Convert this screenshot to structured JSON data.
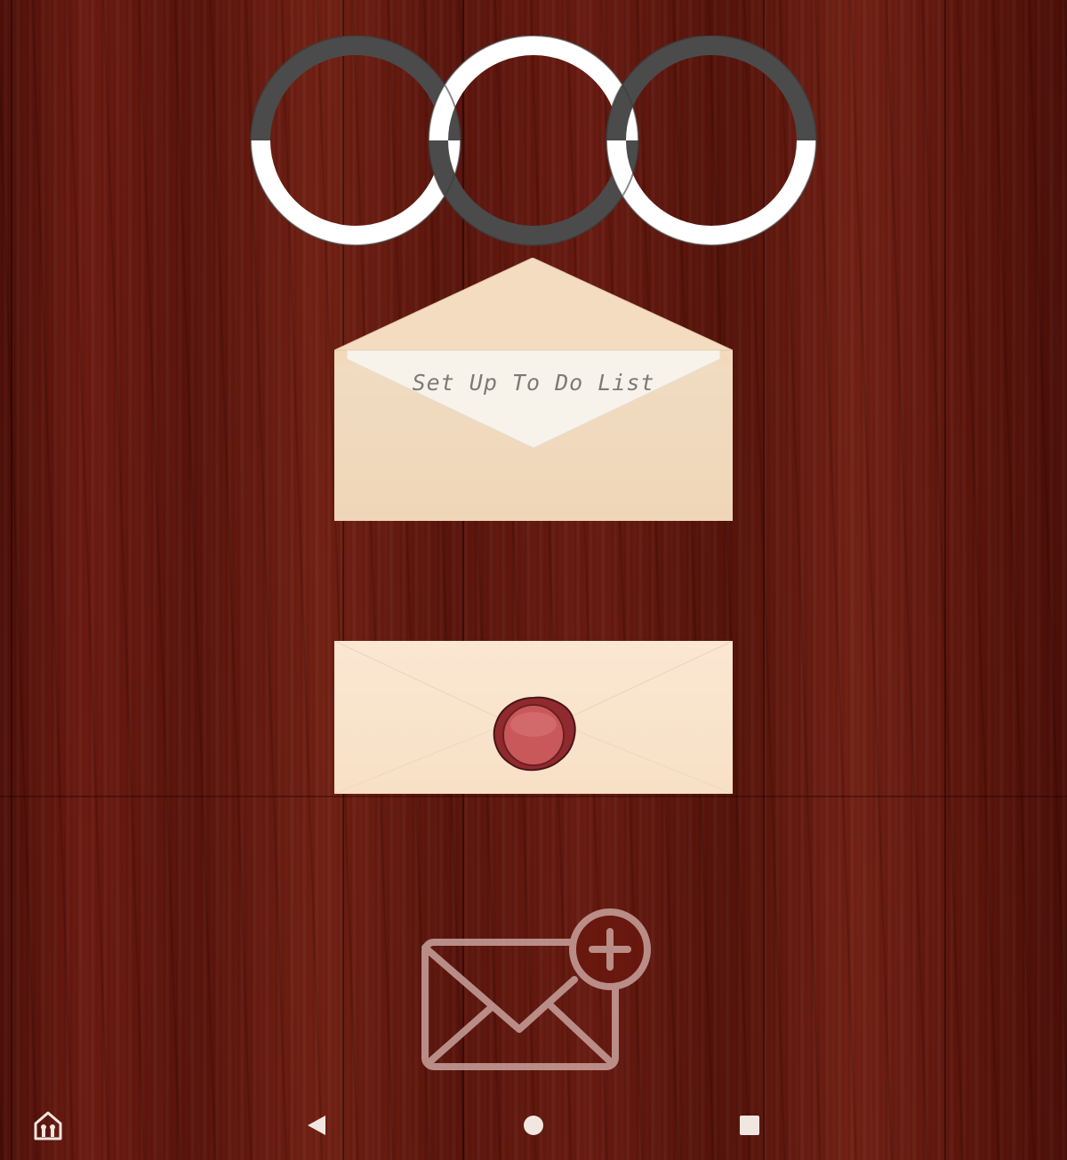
{
  "app": {
    "theme": {
      "wood_color": "#6a180e",
      "ring_dark": "#4a4a4a",
      "ring_light": "#ffffff",
      "envelope_color": "#f1dcc2",
      "paper_color": "#f6f1e8",
      "seal_color": "#c24a4a"
    }
  },
  "progress": {
    "icon": "three-interlocking-rings"
  },
  "open_envelope": {
    "title": "Set Up To Do List",
    "icon": "open-envelope"
  },
  "sealed_envelope": {
    "icon": "wax-seal"
  },
  "compose": {
    "icon": "mail-plus-icon"
  },
  "navbar": {
    "home_icon": "home-app-icon",
    "back_icon": "back-triangle-icon",
    "home_circle_icon": "home-circle-icon",
    "recents_icon": "recents-square-icon"
  }
}
